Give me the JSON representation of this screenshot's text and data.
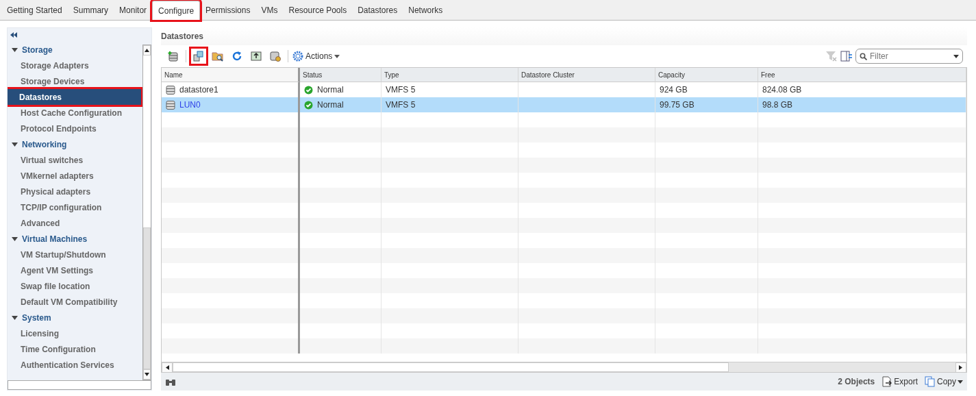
{
  "tabs": [
    {
      "label": "Getting Started",
      "selected": false,
      "highlighted": false
    },
    {
      "label": "Summary",
      "selected": false,
      "highlighted": false
    },
    {
      "label": "Monitor",
      "selected": false,
      "highlighted": false
    },
    {
      "label": "Configure",
      "selected": true,
      "highlighted": true
    },
    {
      "label": "Permissions",
      "selected": false,
      "highlighted": false
    },
    {
      "label": "VMs",
      "selected": false,
      "highlighted": false
    },
    {
      "label": "Resource Pools",
      "selected": false,
      "highlighted": false
    },
    {
      "label": "Datastores",
      "selected": false,
      "highlighted": false
    },
    {
      "label": "Networks",
      "selected": false,
      "highlighted": false
    }
  ],
  "sidebar": {
    "sections": [
      {
        "title": "Storage",
        "expanded": true,
        "items": [
          {
            "label": "Storage Adapters",
            "selected": false,
            "highlighted": false
          },
          {
            "label": "Storage Devices",
            "selected": false,
            "highlighted": false
          },
          {
            "label": "Datastores",
            "selected": true,
            "highlighted": true
          },
          {
            "label": "Host Cache Configuration",
            "selected": false,
            "highlighted": false
          },
          {
            "label": "Protocol Endpoints",
            "selected": false,
            "highlighted": false
          }
        ]
      },
      {
        "title": "Networking",
        "expanded": true,
        "items": [
          {
            "label": "Virtual switches",
            "selected": false,
            "highlighted": false
          },
          {
            "label": "VMkernel adapters",
            "selected": false,
            "highlighted": false
          },
          {
            "label": "Physical adapters",
            "selected": false,
            "highlighted": false
          },
          {
            "label": "TCP/IP configuration",
            "selected": false,
            "highlighted": false
          },
          {
            "label": "Advanced",
            "selected": false,
            "highlighted": false
          }
        ]
      },
      {
        "title": "Virtual Machines",
        "expanded": true,
        "items": [
          {
            "label": "VM Startup/Shutdown",
            "selected": false,
            "highlighted": false
          },
          {
            "label": "Agent VM Settings",
            "selected": false,
            "highlighted": false
          },
          {
            "label": "Swap file location",
            "selected": false,
            "highlighted": false
          },
          {
            "label": "Default VM Compatibility",
            "selected": false,
            "highlighted": false
          }
        ]
      },
      {
        "title": "System",
        "expanded": true,
        "items": [
          {
            "label": "Licensing",
            "selected": false,
            "highlighted": false
          },
          {
            "label": "Time Configuration",
            "selected": false,
            "highlighted": false
          },
          {
            "label": "Authentication Services",
            "selected": false,
            "highlighted": false
          }
        ]
      }
    ]
  },
  "panel": {
    "title": "Datastores"
  },
  "toolbar": {
    "buttons": [
      {
        "kind": "new",
        "highlighted": false
      },
      {
        "kind": "cluster",
        "highlighted": true
      },
      {
        "kind": "browse",
        "highlighted": false
      },
      {
        "kind": "refresh",
        "highlighted": false
      },
      {
        "kind": "upload",
        "highlighted": false
      },
      {
        "kind": "settings",
        "highlighted": false
      }
    ],
    "actions": "Actions",
    "filter_placeholder": "Filter"
  },
  "table": {
    "columns": [
      "Name",
      "Status",
      "Type",
      "Datastore Cluster",
      "Capacity",
      "Free"
    ],
    "rows": [
      {
        "name": "datastore1",
        "status": "Normal",
        "type": "VMFS 5",
        "cluster": "",
        "capacity": "924  GB",
        "free": "824.08  GB",
        "selected": false
      },
      {
        "name": "LUN0",
        "status": "Normal",
        "type": "VMFS 5",
        "cluster": "",
        "capacity": "99.75  GB",
        "free": "98.8  GB",
        "selected": true
      }
    ]
  },
  "footer": {
    "count": "2 Objects",
    "export": "Export",
    "copy": "Copy"
  }
}
